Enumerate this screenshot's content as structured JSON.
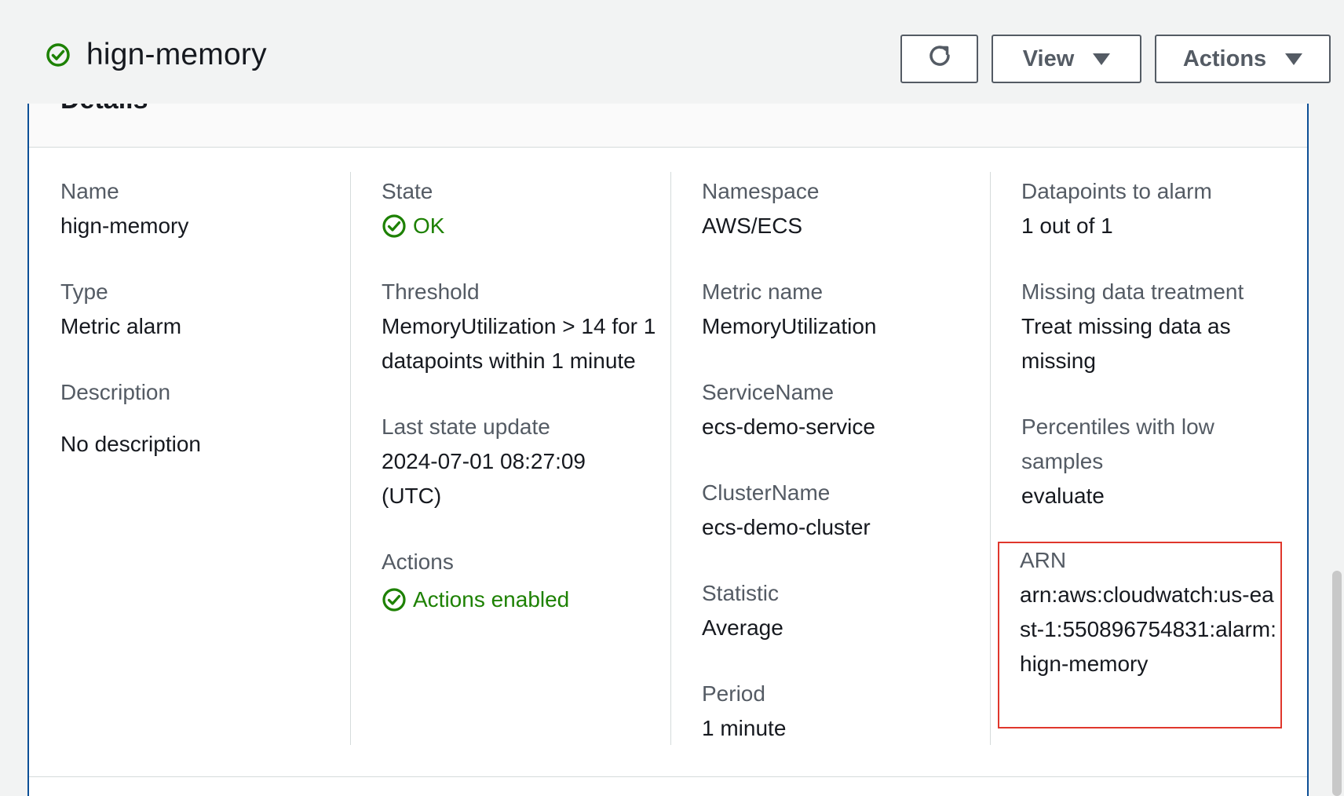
{
  "header": {
    "title": "hign-memory",
    "status_icon": "check-circle-icon",
    "refresh_icon": "refresh-icon",
    "view_label": "View",
    "actions_label": "Actions"
  },
  "details": {
    "section_title": "Details",
    "name": {
      "label": "Name",
      "value": "hign-memory"
    },
    "type": {
      "label": "Type",
      "value": "Metric alarm"
    },
    "description": {
      "label": "Description",
      "value": "No description"
    },
    "state": {
      "label": "State",
      "value": "OK"
    },
    "threshold": {
      "label": "Threshold",
      "value": "MemoryUtilization > 14 for 1 datapoints within 1 minute"
    },
    "last_state_update": {
      "label": "Last state update",
      "value": "2024-07-01 08:27:09 (UTC)"
    },
    "actions": {
      "label": "Actions",
      "value": "Actions enabled"
    },
    "namespace": {
      "label": "Namespace",
      "value": "AWS/ECS"
    },
    "metric_name": {
      "label": "Metric name",
      "value": "MemoryUtilization"
    },
    "service_name": {
      "label": "ServiceName",
      "value": "ecs-demo-service"
    },
    "cluster_name": {
      "label": "ClusterName",
      "value": "ecs-demo-cluster"
    },
    "statistic": {
      "label": "Statistic",
      "value": "Average"
    },
    "period": {
      "label": "Period",
      "value": "1 minute"
    },
    "datapoints_to_alarm": {
      "label": "Datapoints to alarm",
      "value": "1 out of 1"
    },
    "missing_data_treatment": {
      "label": "Missing data treatment",
      "value": "Treat missing data as missing"
    },
    "percentiles_low_samples": {
      "label": "Percentiles with low samples",
      "value": "evaluate"
    },
    "arn": {
      "label": "ARN",
      "value": "arn:aws:cloudwatch:us-east-1:550896754831:alarm:hign-memory"
    }
  },
  "colors": {
    "success_green": "#1d8102",
    "highlight_red": "#e0372c",
    "panel_border_blue": "#0d4f96"
  }
}
